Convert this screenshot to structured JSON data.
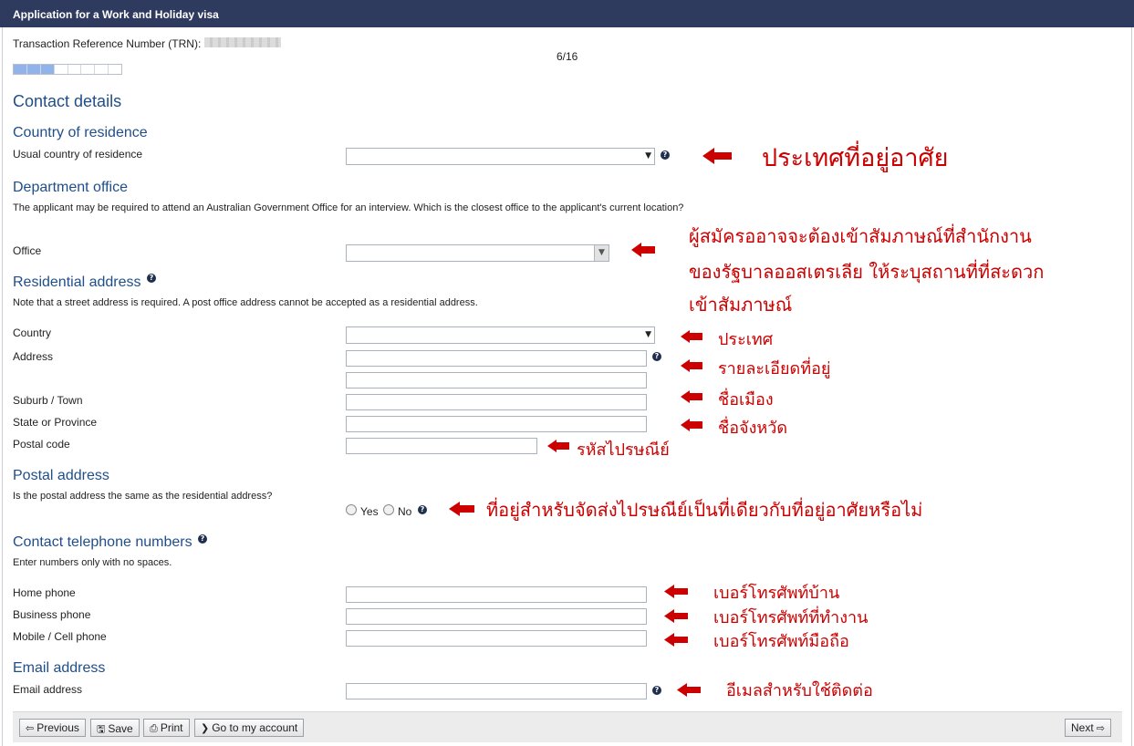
{
  "window": {
    "title": "Application for a Work and Holiday visa"
  },
  "header": {
    "trn_label": "Transaction Reference Number (TRN):",
    "progress_text": "6/16",
    "progress": {
      "current": 6,
      "total": 16
    }
  },
  "page_title": "Contact details",
  "country_of_residence": {
    "heading": "Country of residence",
    "label": "Usual country of residence",
    "value": ""
  },
  "department_office": {
    "heading": "Department office",
    "note": "The applicant may be required to attend an Australian Government Office for an interview. Which is the closest office to the applicant's current location?",
    "office_label": "Office",
    "office_value": ""
  },
  "residential_address": {
    "heading": "Residential address",
    "note": "Note that a street address is required. A post office address cannot be accepted as a residential address.",
    "country_label": "Country",
    "address_label": "Address",
    "suburb_label": "Suburb / Town",
    "state_label": "State or Province",
    "postal_label": "Postal code"
  },
  "postal_address": {
    "heading": "Postal address",
    "question": "Is the postal address the same as the residential address?",
    "yes_label": "Yes",
    "no_label": "No"
  },
  "telephone": {
    "heading": "Contact telephone numbers",
    "note": "Enter numbers only with no spaces.",
    "home_label": "Home phone",
    "business_label": "Business phone",
    "mobile_label": "Mobile / Cell phone"
  },
  "email": {
    "heading": "Email address",
    "label": "Email address"
  },
  "annotations": {
    "country_of_residence": "ประเทศที่อยู่อาศัย",
    "office_line1": "ผู้สมัครออาจจะต้องเข้าสัมภาษณ์ที่สำนักงาน",
    "office_line2": "ของรัฐบาลออสเตรเลีย ให้ระบุสถานที่ที่สะดวก",
    "office_line3": "เข้าสัมภาษณ์",
    "country": "ประเทศ",
    "address": "รายละเอียดที่อยู่",
    "suburb": "ชื่อเมือง",
    "state": "ชื่อจังหวัด",
    "postal": "รหัสไปรษณีย์",
    "postal_same": "ที่อยู่สำหรับจัดส่งไปรษณีย์เป็นที่เดียวกับที่อยู่อาศัยหรือไม่",
    "home_phone": "เบอร์โทรศัพท์บ้าน",
    "business_phone": "เบอร์โทรศัพท์ที่ทำงาน",
    "mobile_phone": "เบอร์โทรศัพท์มือถือ",
    "email": "อีเมลสำหรับใช้ติดต่อ"
  },
  "toolbar": {
    "previous": "Previous",
    "save": "Save",
    "print": "Print",
    "account": "Go to my account",
    "next": "Next"
  },
  "colors": {
    "title_bar": "#2e3b5f",
    "heading": "#1f4e8a",
    "annotation": "#cc0000"
  }
}
